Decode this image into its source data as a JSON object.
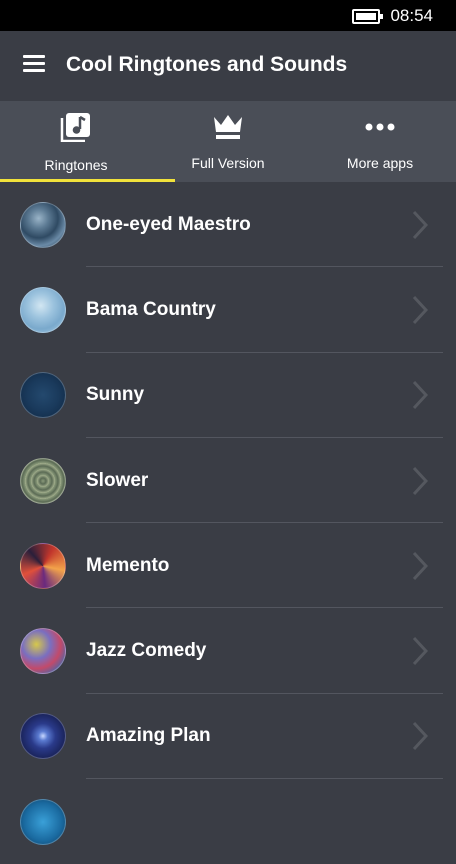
{
  "status_bar": {
    "time": "08:54"
  },
  "header": {
    "title": "Cool Ringtones and Sounds"
  },
  "tabs": [
    {
      "label": "Ringtones",
      "icon": "music-note-icon",
      "active": true
    },
    {
      "label": "Full Version",
      "icon": "crown-icon",
      "active": false
    },
    {
      "label": "More apps",
      "icon": "more-dots-icon",
      "active": false
    }
  ],
  "accent": "#f1e23b",
  "ringtones": [
    {
      "title": "One-eyed Maestro"
    },
    {
      "title": "Bama Country"
    },
    {
      "title": "Sunny"
    },
    {
      "title": "Slower"
    },
    {
      "title": "Memento"
    },
    {
      "title": "Jazz Comedy"
    },
    {
      "title": "Amazing Plan"
    },
    {
      "title": ""
    }
  ]
}
